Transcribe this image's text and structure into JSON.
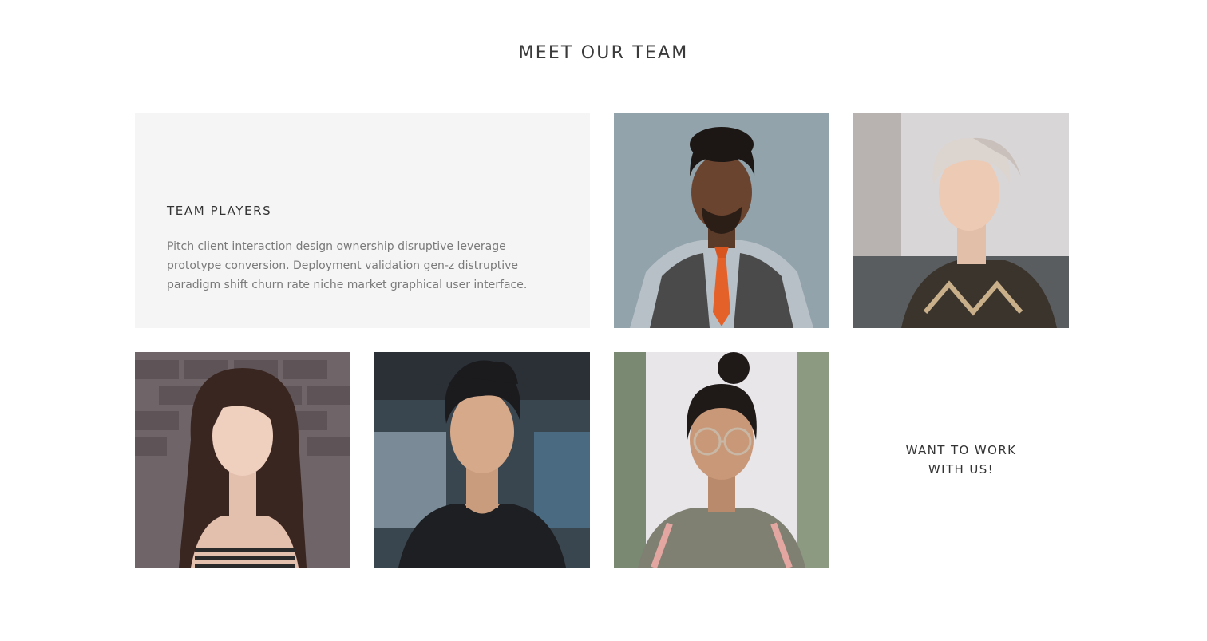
{
  "section": {
    "title": "MEET OUR TEAM"
  },
  "intro": {
    "title": "TEAM PLAYERS",
    "text": "Pitch client interaction design ownership disruptive leverage prototype conversion. Deployment validation gen-z distruptive paradigm shift churn rate niche market graphical user interface."
  },
  "members": [
    {
      "photo": "man-orange-tie-portrait"
    },
    {
      "photo": "woman-short-blonde-hair-portrait"
    },
    {
      "photo": "woman-long-brown-hair-portrait"
    },
    {
      "photo": "man-dark-curly-hair-portrait"
    },
    {
      "photo": "woman-glasses-hair-bun-portrait"
    }
  ],
  "cta": {
    "label": "WANT TO WORK WITH US!"
  },
  "colors": {
    "intro_background": "#f5f5f5",
    "heading": "#3a3a3a",
    "body_text": "#7a7a7a"
  }
}
